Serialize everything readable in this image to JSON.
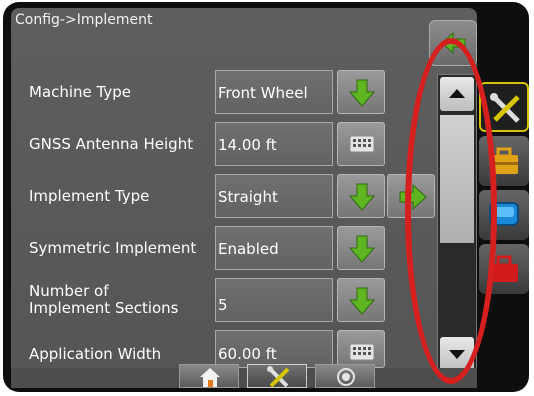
{
  "header": {
    "title": "Config->Implement",
    "back_icon": "back-arrow-icon"
  },
  "settings": [
    {
      "label": "Machine Type",
      "value": "Front Wheel",
      "action_icon": "down-arrow-icon"
    },
    {
      "label": "GNSS Antenna Height",
      "value": "14.00 ft",
      "action_icon": "keyboard-icon"
    },
    {
      "label": "Implement Type",
      "value": "Straight",
      "action_icon": "down-arrow-icon",
      "extra_icon": "right-arrow-icon"
    },
    {
      "label": "Symmetric Implement",
      "value": "Enabled",
      "action_icon": "down-arrow-icon"
    },
    {
      "label": "Number of\nImplement Sections",
      "value": "5",
      "action_icon": "down-arrow-icon"
    },
    {
      "label": "Application Width",
      "value": "60.00 ft",
      "action_icon": "keyboard-icon"
    }
  ],
  "scrollbar": {
    "up_icon": "scroll-up-icon",
    "down_icon": "scroll-down-icon"
  },
  "bottom_tabs": [
    {
      "icon": "home-icon",
      "active": false
    },
    {
      "icon": "wrench-screwdriver-icon",
      "active": true
    },
    {
      "icon": "target-icon",
      "active": false
    }
  ],
  "right_tabs": [
    {
      "icon": "wrench-screwdriver-icon",
      "active": true
    },
    {
      "icon": "toolbox-icon",
      "active": false
    },
    {
      "icon": "display-icon",
      "active": false
    },
    {
      "icon": "red-toolbox-icon",
      "active": false
    }
  ],
  "colors": {
    "accent_green": "#5fb521",
    "annotation_red": "#d61f1f",
    "active_tab_border": "#d4c300"
  }
}
